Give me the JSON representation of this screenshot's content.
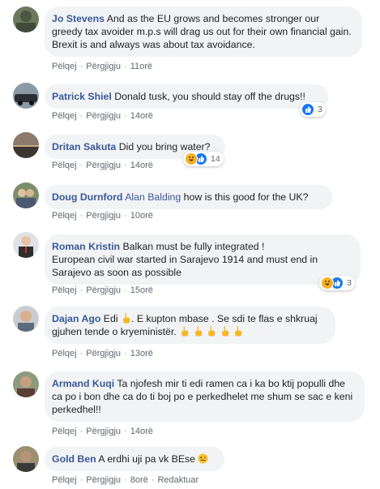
{
  "actions": {
    "like": "Pëlqej",
    "reply": "Përgjigju",
    "edited": "Redaktuar"
  },
  "comments": [
    {
      "author": "Jo Stevens",
      "text": "And as the EU grows and becomes stronger our greedy tax avoider m.p.s will drag us out for their own financial gain. Brexit is and always was about tax avoidance.",
      "time": "11orë"
    },
    {
      "author": "Patrick Shiel",
      "text": "Donald tusk, you should stay off the drugs!!",
      "time": "14orë",
      "reactions": {
        "icons": [
          "like-icon"
        ],
        "count": "3"
      }
    },
    {
      "author": "Dritan Sakuta",
      "text": "Did you bring water?",
      "time": "14orë",
      "reactions": {
        "icons": [
          "haha-icon",
          "like-icon"
        ],
        "count": "14"
      }
    },
    {
      "author": "Doug Durnford",
      "mention": "Alan Balding",
      "text": "how is this good for the UK?",
      "time": "10orë"
    },
    {
      "author": "Roman Kristin",
      "text": "Balkan must be fully integrated !",
      "text2": "European civil war started in Sarajevo 1914 and must end in Sarajevo as soon as possible",
      "time": "15orë",
      "reactions": {
        "icons": [
          "haha-icon",
          "like-icon"
        ],
        "count": "3"
      }
    },
    {
      "author": "Dajan Ago",
      "text_a": "Edi",
      "text_b": ". E kupton mbase . Se sdi te flas e shkruaj gjuhen tende o kryeministër.",
      "time": "13orë"
    },
    {
      "author": "Armand Kuqi",
      "text": "Ta njofesh mir ti edi ramen ca i ka bo ktij populli dhe ca po i bon dhe ca do ti boj po e perkedhelet me shum se sac e keni perkedhel!!",
      "time": "14orë"
    },
    {
      "author": "Gold Ben",
      "text": "A erdhi uji pa vk BEse",
      "time": "8orë"
    }
  ],
  "colors": {
    "author": "#385898",
    "bubble": "#f2f3f5",
    "meta": "#606770",
    "like": "#1877f2",
    "haha": "#f7b125"
  }
}
